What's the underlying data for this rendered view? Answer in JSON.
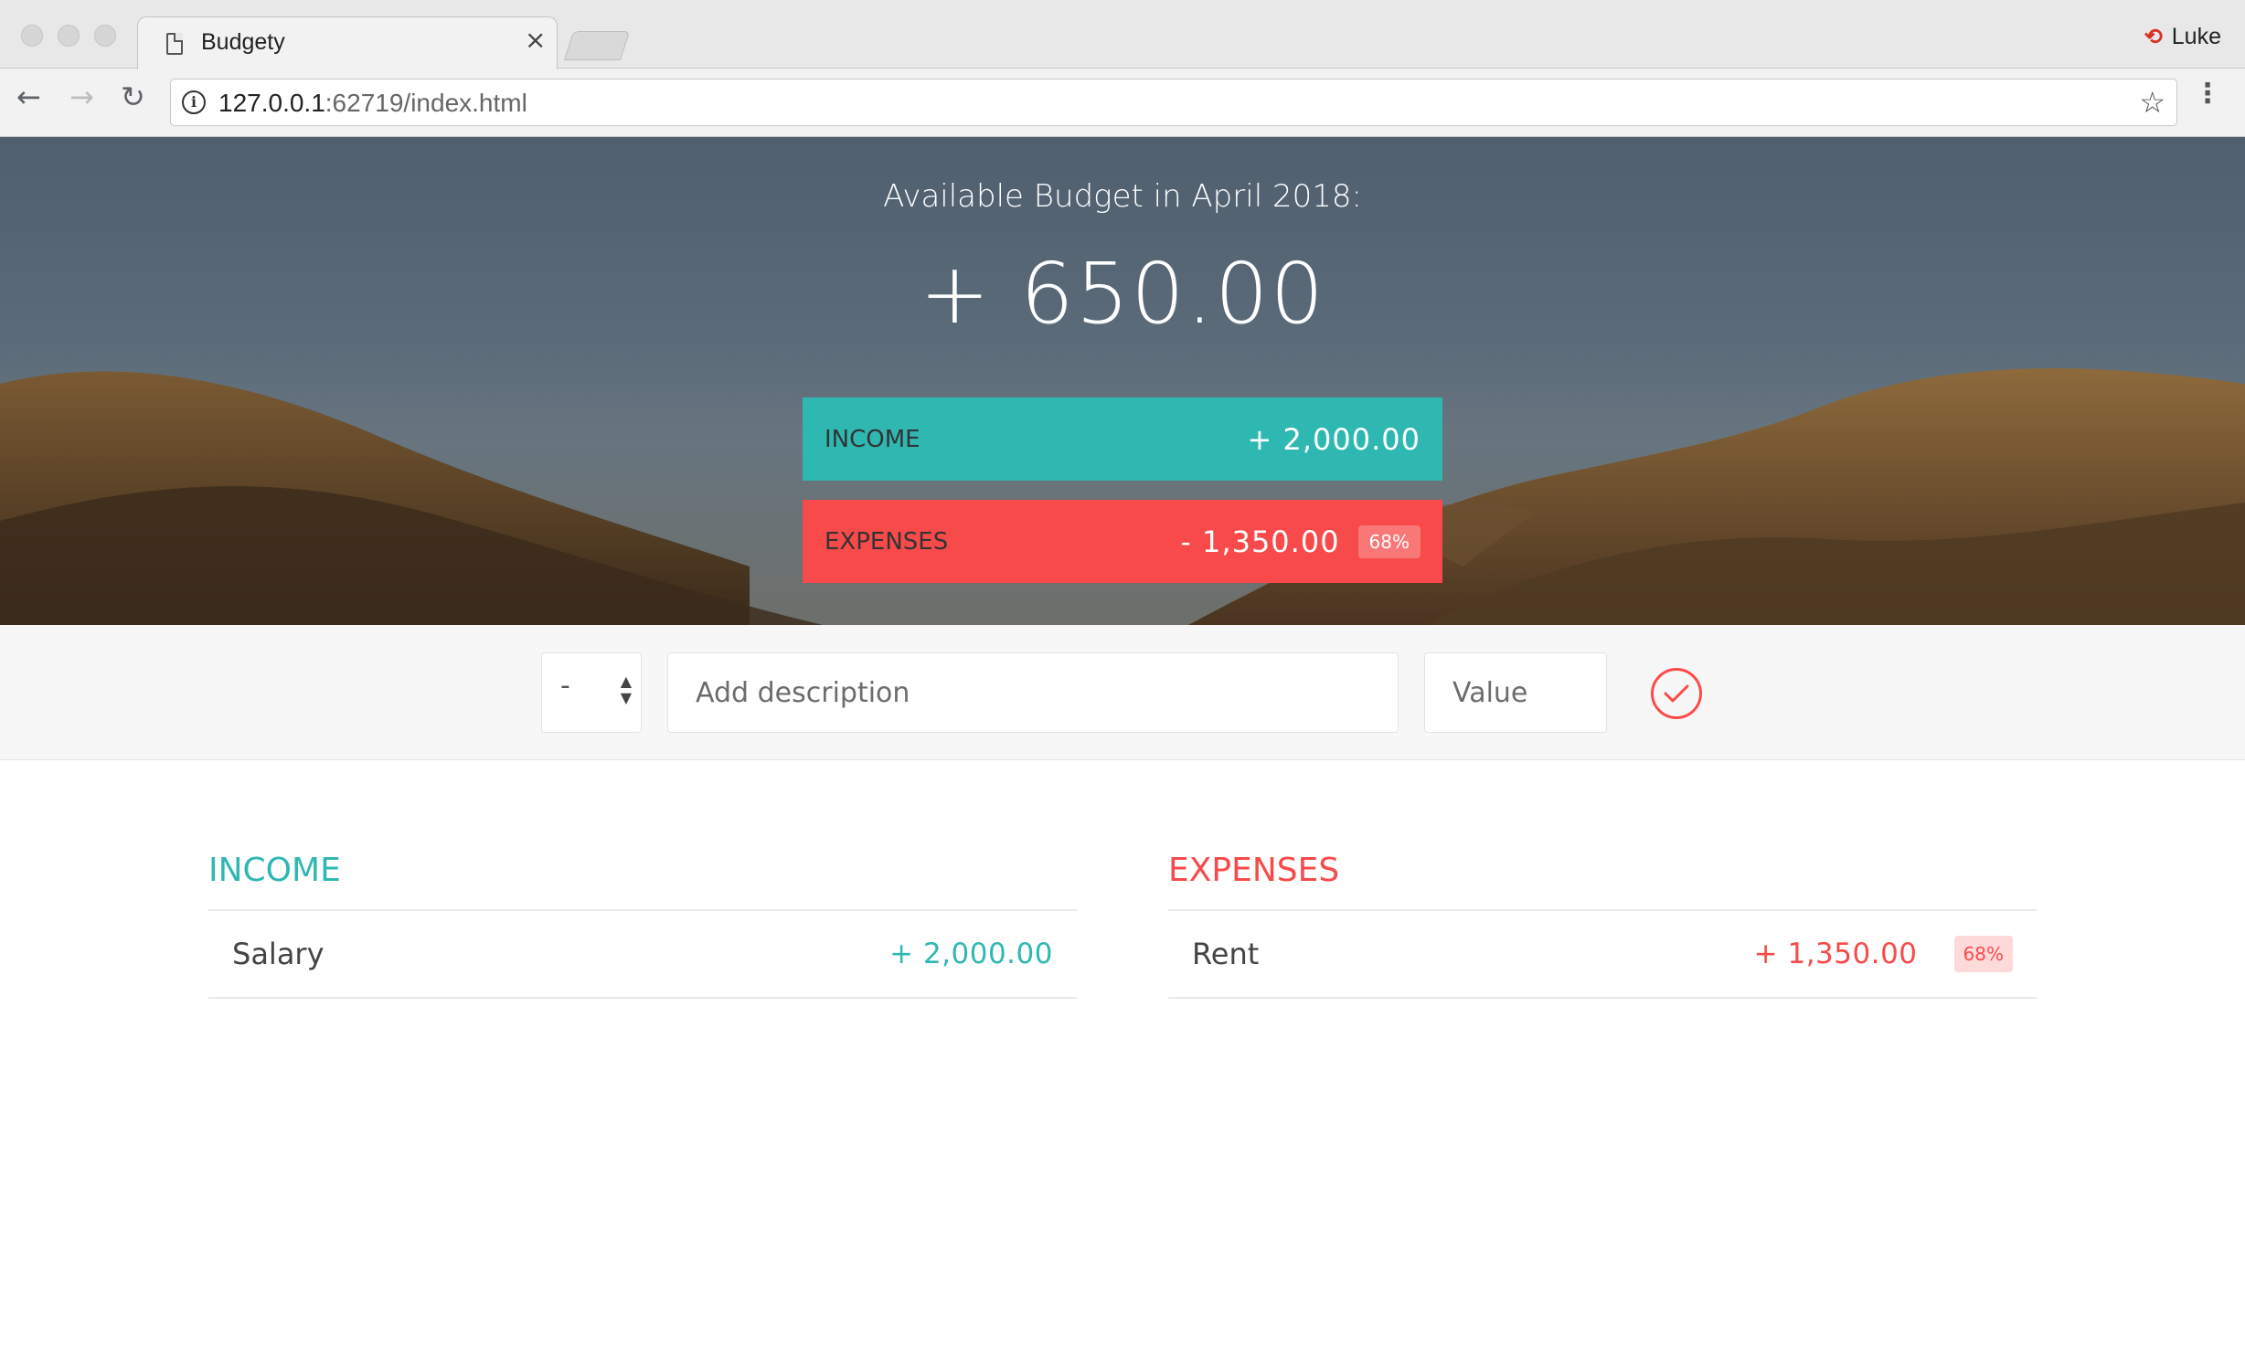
{
  "browser": {
    "tab_title": "Budgety",
    "tab_close": "×",
    "profile_name": "Luke",
    "url_host": "127.0.0.1",
    "url_rest": ":62719/index.html"
  },
  "budget": {
    "title": "Available Budget in April 2018:",
    "value": "+ 650.00",
    "income_label": "Income",
    "income_value": "+ 2,000.00",
    "expenses_label": "Expenses",
    "expenses_value": "- 1,350.00",
    "expenses_percentage": "68%"
  },
  "add_form": {
    "type_value": "-",
    "description_placeholder": "Add description",
    "value_placeholder": "Value"
  },
  "income_list": {
    "title": "Income",
    "items": [
      {
        "description": "Salary",
        "value": "+ 2,000.00"
      }
    ]
  },
  "expenses_list": {
    "title": "Expenses",
    "items": [
      {
        "description": "Rent",
        "value": "+ 1,350.00",
        "percentage": "68%"
      }
    ]
  },
  "colors": {
    "income": "#2fb8b2",
    "expenses": "#f84a4a"
  }
}
